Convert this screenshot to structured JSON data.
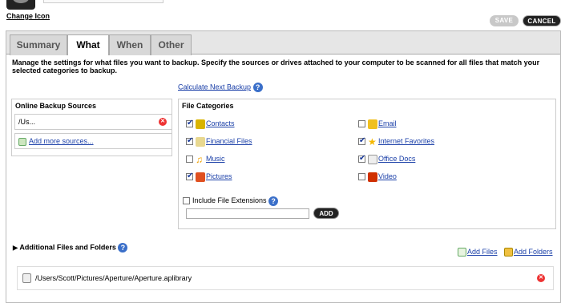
{
  "header": {
    "change_icon": "Change Icon",
    "save": "SAVE",
    "cancel": "CANCEL"
  },
  "tabs": [
    {
      "label": "Summary",
      "active": false
    },
    {
      "label": "What",
      "active": true
    },
    {
      "label": "When",
      "active": false
    },
    {
      "label": "Other",
      "active": false
    }
  ],
  "description": "Manage the settings for what files you want to backup. Specify the sources or drives attached to your computer to be scanned for all files that match your selected categories to backup.",
  "calc_link": "Calculate Next Backup",
  "sources": {
    "title": "Online Backup Sources",
    "items": [
      "/Us..."
    ],
    "add_more": "Add more sources..."
  },
  "categories": {
    "title": "File Categories",
    "items": [
      {
        "label": "Contacts",
        "checked": true,
        "icon": "contacts-icon",
        "color": "#d9b400"
      },
      {
        "label": "Email",
        "checked": false,
        "icon": "email-icon",
        "color": "#f0c020"
      },
      {
        "label": "Financial Files",
        "checked": true,
        "icon": "financial-icon",
        "color": "#e8d890"
      },
      {
        "label": "Internet Favorites",
        "checked": true,
        "icon": "star-icon",
        "color": "#f5b800"
      },
      {
        "label": "Music",
        "checked": false,
        "icon": "music-icon",
        "color": "#f0a000"
      },
      {
        "label": "Office Docs",
        "checked": true,
        "icon": "docs-icon",
        "color": "#dddddd"
      },
      {
        "label": "Pictures",
        "checked": true,
        "icon": "pictures-icon",
        "color": "#e05020"
      },
      {
        "label": "Video",
        "checked": false,
        "icon": "video-icon",
        "color": "#d03000"
      }
    ]
  },
  "extensions": {
    "label": "Include File Extensions",
    "checked": false,
    "value": "",
    "add": "ADD"
  },
  "additional": {
    "title": "Additional Files and Folders",
    "add_files": "Add Files",
    "add_folders": "Add Folders",
    "items": [
      "/Users/Scott/Pictures/Aperture/Aperture.aplibrary"
    ]
  }
}
